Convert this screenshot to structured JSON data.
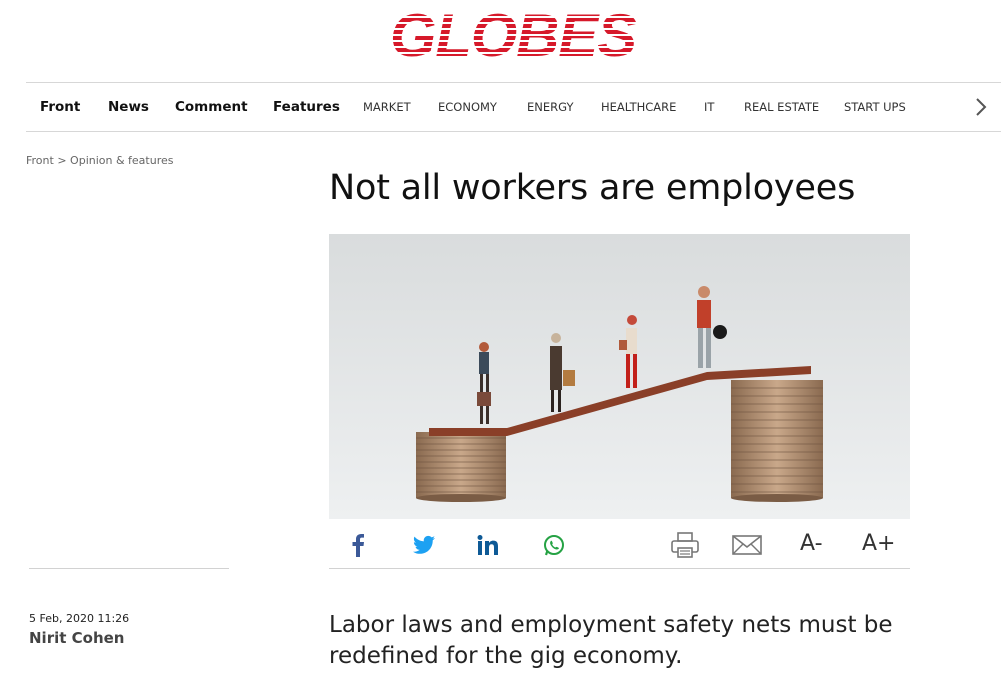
{
  "site": {
    "logo_text": "GLOBES",
    "brand_color": "#d6192a"
  },
  "nav": {
    "main_items": [
      "Front",
      "News",
      "Comment",
      "Features"
    ],
    "sub_items": [
      "MARKET",
      "ECONOMY",
      "ENERGY",
      "HEALTHCARE",
      "IT",
      "REAL ESTATE",
      "START UPS"
    ],
    "more_icon": "chevron-right-icon"
  },
  "breadcrumb": {
    "home": "Front",
    "separator": " > ",
    "section": "Opinion & features"
  },
  "article": {
    "title": "Not all workers are employees",
    "subtitle": "Labor laws and employment safety nets must be redefined for the gig economy.",
    "date": "5 Feb, 2020 11:26",
    "author": "Nirit Cohen",
    "image_alt": "Miniature people walking up a plank between stacks of coins"
  },
  "share": {
    "facebook_icon": "facebook-icon",
    "twitter_icon": "twitter-icon",
    "linkedin_icon": "linkedin-icon",
    "whatsapp_icon": "whatsapp-icon",
    "print_icon": "print-icon",
    "email_icon": "email-icon",
    "font_decrease": "A-",
    "font_increase": "A+",
    "colors": {
      "facebook": "#3b5998",
      "twitter": "#1da1f2",
      "linkedin": "#0e76a8",
      "whatsapp": "#25a244"
    }
  }
}
